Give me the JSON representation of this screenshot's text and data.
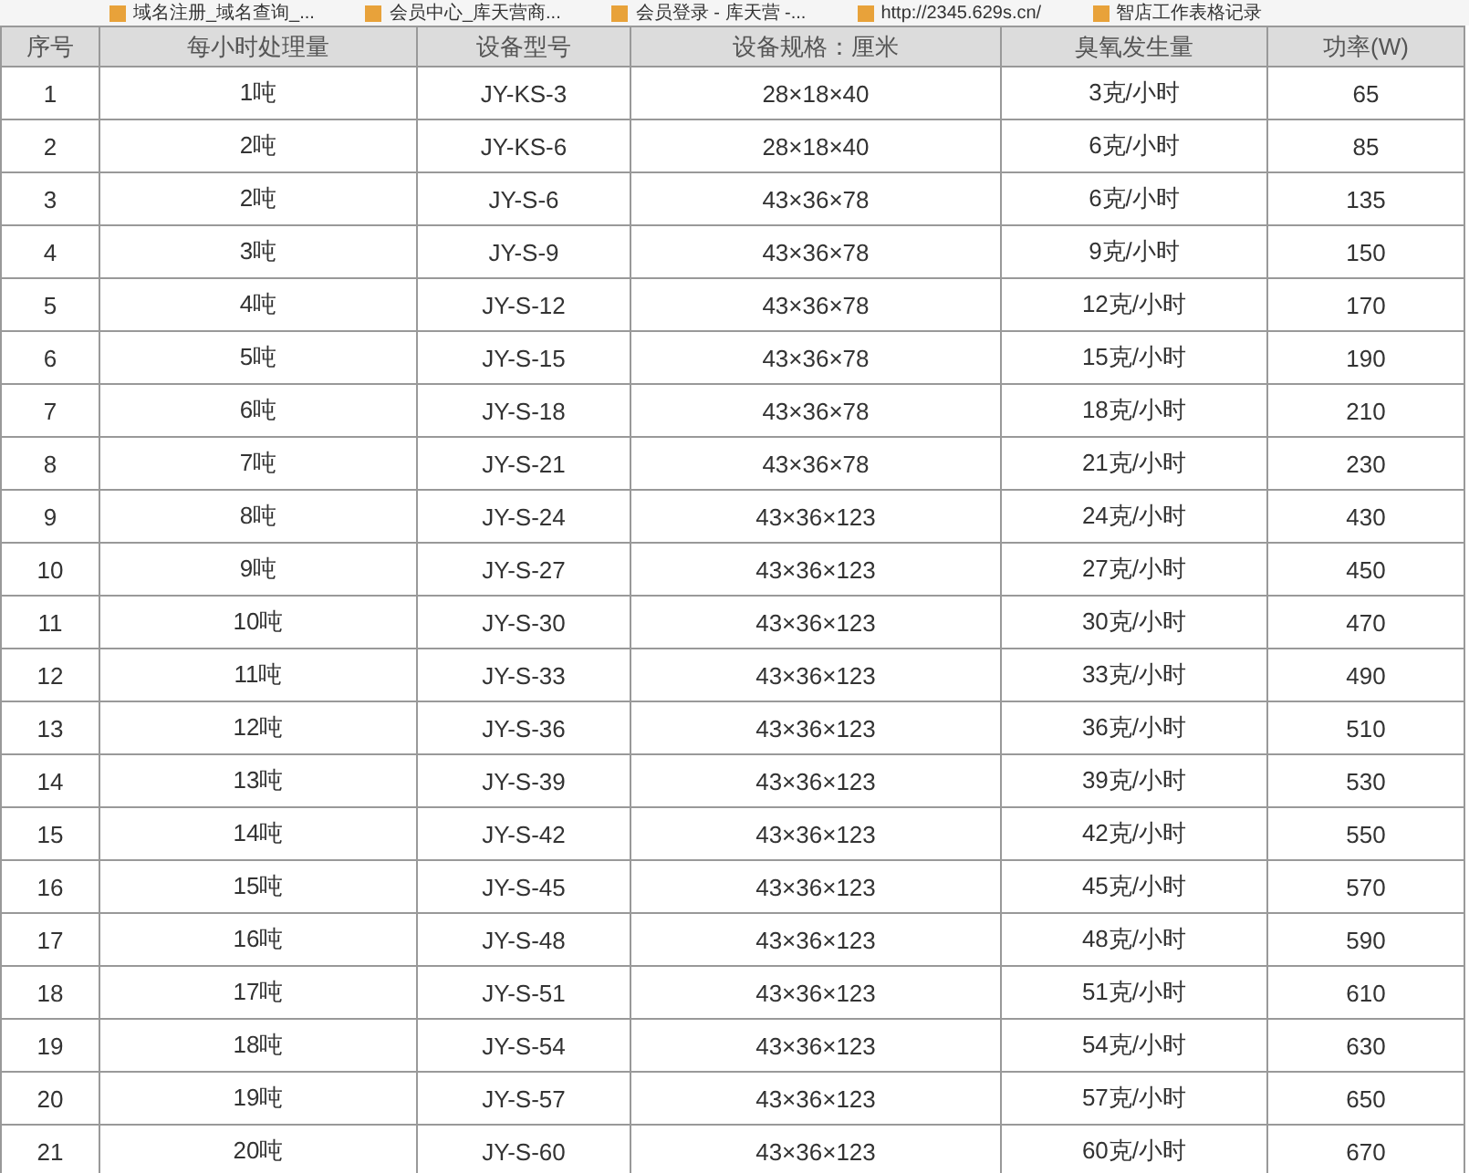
{
  "bookmarks": [
    {
      "label": "域名注册_域名查询_..."
    },
    {
      "label": "会员中心_库天营商..."
    },
    {
      "label": "会员登录 - 库天营 -..."
    },
    {
      "label": "http://2345.629s.cn/"
    },
    {
      "label": "智店工作表格记录"
    }
  ],
  "table": {
    "columns": [
      "序号",
      "每小时处理量",
      "设备型号",
      "设备规格：厘米",
      "臭氧发生量",
      "功率(W)"
    ],
    "rows": [
      [
        "1",
        "1吨",
        "JY-KS-3",
        "28×18×40",
        "3克/小时",
        "65"
      ],
      [
        "2",
        "2吨",
        "JY-KS-6",
        "28×18×40",
        "6克/小时",
        "85"
      ],
      [
        "3",
        "2吨",
        "JY-S-6",
        "43×36×78",
        "6克/小时",
        "135"
      ],
      [
        "4",
        "3吨",
        "JY-S-9",
        "43×36×78",
        "9克/小时",
        "150"
      ],
      [
        "5",
        "4吨",
        "JY-S-12",
        "43×36×78",
        "12克/小时",
        "170"
      ],
      [
        "6",
        "5吨",
        "JY-S-15",
        "43×36×78",
        "15克/小时",
        "190"
      ],
      [
        "7",
        "6吨",
        "JY-S-18",
        "43×36×78",
        "18克/小时",
        "210"
      ],
      [
        "8",
        "7吨",
        "JY-S-21",
        "43×36×78",
        "21克/小时",
        "230"
      ],
      [
        "9",
        "8吨",
        "JY-S-24",
        "43×36×123",
        "24克/小时",
        "430"
      ],
      [
        "10",
        "9吨",
        "JY-S-27",
        "43×36×123",
        "27克/小时",
        "450"
      ],
      [
        "11",
        "10吨",
        "JY-S-30",
        "43×36×123",
        "30克/小时",
        "470"
      ],
      [
        "12",
        "11吨",
        "JY-S-33",
        "43×36×123",
        "33克/小时",
        "490"
      ],
      [
        "13",
        "12吨",
        "JY-S-36",
        "43×36×123",
        "36克/小时",
        "510"
      ],
      [
        "14",
        "13吨",
        "JY-S-39",
        "43×36×123",
        "39克/小时",
        "530"
      ],
      [
        "15",
        "14吨",
        "JY-S-42",
        "43×36×123",
        "42克/小时",
        "550"
      ],
      [
        "16",
        "15吨",
        "JY-S-45",
        "43×36×123",
        "45克/小时",
        "570"
      ],
      [
        "17",
        "16吨",
        "JY-S-48",
        "43×36×123",
        "48克/小时",
        "590"
      ],
      [
        "18",
        "17吨",
        "JY-S-51",
        "43×36×123",
        "51克/小时",
        "610"
      ],
      [
        "19",
        "18吨",
        "JY-S-54",
        "43×36×123",
        "54克/小时",
        "630"
      ],
      [
        "20",
        "19吨",
        "JY-S-57",
        "43×36×123",
        "57克/小时",
        "650"
      ],
      [
        "21",
        "20吨",
        "JY-S-60",
        "43×36×123",
        "60克/小时",
        "670"
      ]
    ]
  }
}
